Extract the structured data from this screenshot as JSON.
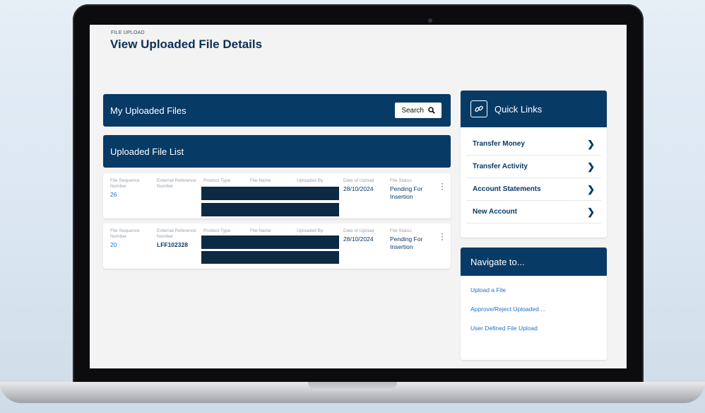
{
  "breadcrumb": "FILE UPLOAD",
  "page_title": "View Uploaded File Details",
  "my_uploaded_files": {
    "title": "My Uploaded Files",
    "search_label": "Search"
  },
  "file_list_title": "Uploaded File List",
  "columns": [
    "File Sequence Number",
    "External Reference Number",
    "Product Type",
    "File Name",
    "Uploaded By",
    "Date of Upload",
    "File Status"
  ],
  "rows": [
    {
      "sequence": "26",
      "external_ref": "",
      "date": "28/10/2024",
      "status": "Pending For Insertion"
    },
    {
      "sequence": "20",
      "external_ref": "LFF102328",
      "date": "28/10/2024",
      "status": "Pending For Insertion"
    }
  ],
  "quick_links": {
    "title": "Quick Links",
    "items": [
      "Transfer Money",
      "Transfer Activity",
      "Account Statements",
      "New Account"
    ]
  },
  "navigate": {
    "title": "Navigate to...",
    "links": [
      "Upload a File",
      "Approve/Reject Uploaded ...",
      "User Defined File Upload"
    ]
  },
  "colors": {
    "primary": "#083a66",
    "link": "#1f72c9",
    "page_bg": "#f3f3f3"
  },
  "icons": [
    "search-icon",
    "link-icon",
    "chevron-right-icon",
    "kebab-menu-icon"
  ]
}
